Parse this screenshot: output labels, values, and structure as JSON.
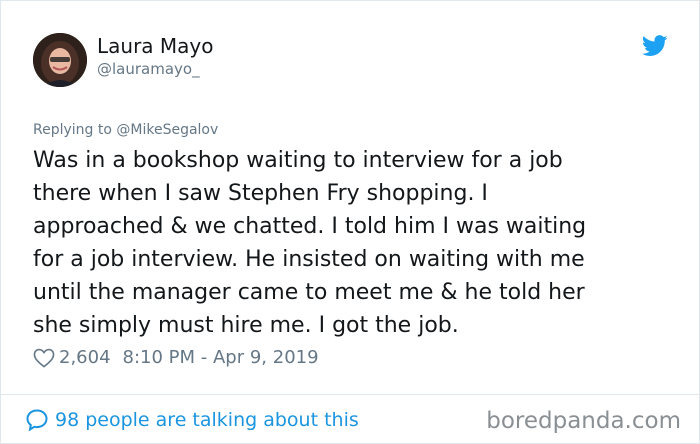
{
  "tweet": {
    "author": {
      "name": "Laura Mayo",
      "handle": "@lauramayo_"
    },
    "replying_to": "Replying to @MikeSegalov",
    "text_lines": [
      "Was in a bookshop waiting to interview for a job",
      "there when I saw Stephen Fry shopping. I",
      "approached & we chatted. I told him I was waiting",
      "for a job interview. He insisted on waiting with me",
      "until the manager came to meet me & he told her",
      "she simply must hire me. I got the job."
    ],
    "likes": "2,604",
    "timestamp": "8:10 PM - Apr 9, 2019",
    "talking": "98 people are talking about this"
  },
  "watermark": "boredpanda.com",
  "icons": {
    "brand": "twitter-bird-icon",
    "like": "heart-icon",
    "conversation": "speech-bubble-icon"
  },
  "colors": {
    "twitter_blue": "#1da1f2",
    "link_blue": "#1b95e0",
    "muted_text": "#657786",
    "primary_text": "#14171a"
  }
}
